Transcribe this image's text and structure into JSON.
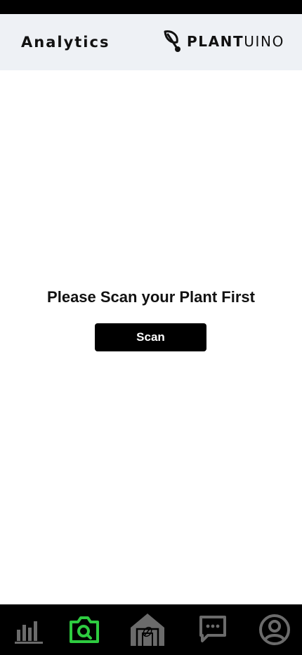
{
  "header": {
    "title": "Analytics",
    "brand": {
      "bold": "PLANT",
      "light": "UINO",
      "icon": "leaf-logo-icon"
    }
  },
  "main": {
    "prompt": "Please Scan your Plant First",
    "scan_label": "Scan"
  },
  "bottom_nav": {
    "items": [
      {
        "icon": "bar-chart-icon",
        "active": false
      },
      {
        "icon": "camera-search-icon",
        "active": true
      },
      {
        "icon": "home-leaf-icon",
        "active": false
      },
      {
        "icon": "chat-icon",
        "active": false
      },
      {
        "icon": "profile-icon",
        "active": false
      }
    ],
    "colors": {
      "active": "#2ecc40",
      "inactive": "#6b6b6b",
      "background": "#000000"
    }
  },
  "colors": {
    "header_bg": "#eef1f5",
    "status_bar": "#000000",
    "button_bg": "#000000",
    "button_text": "#ffffff"
  }
}
